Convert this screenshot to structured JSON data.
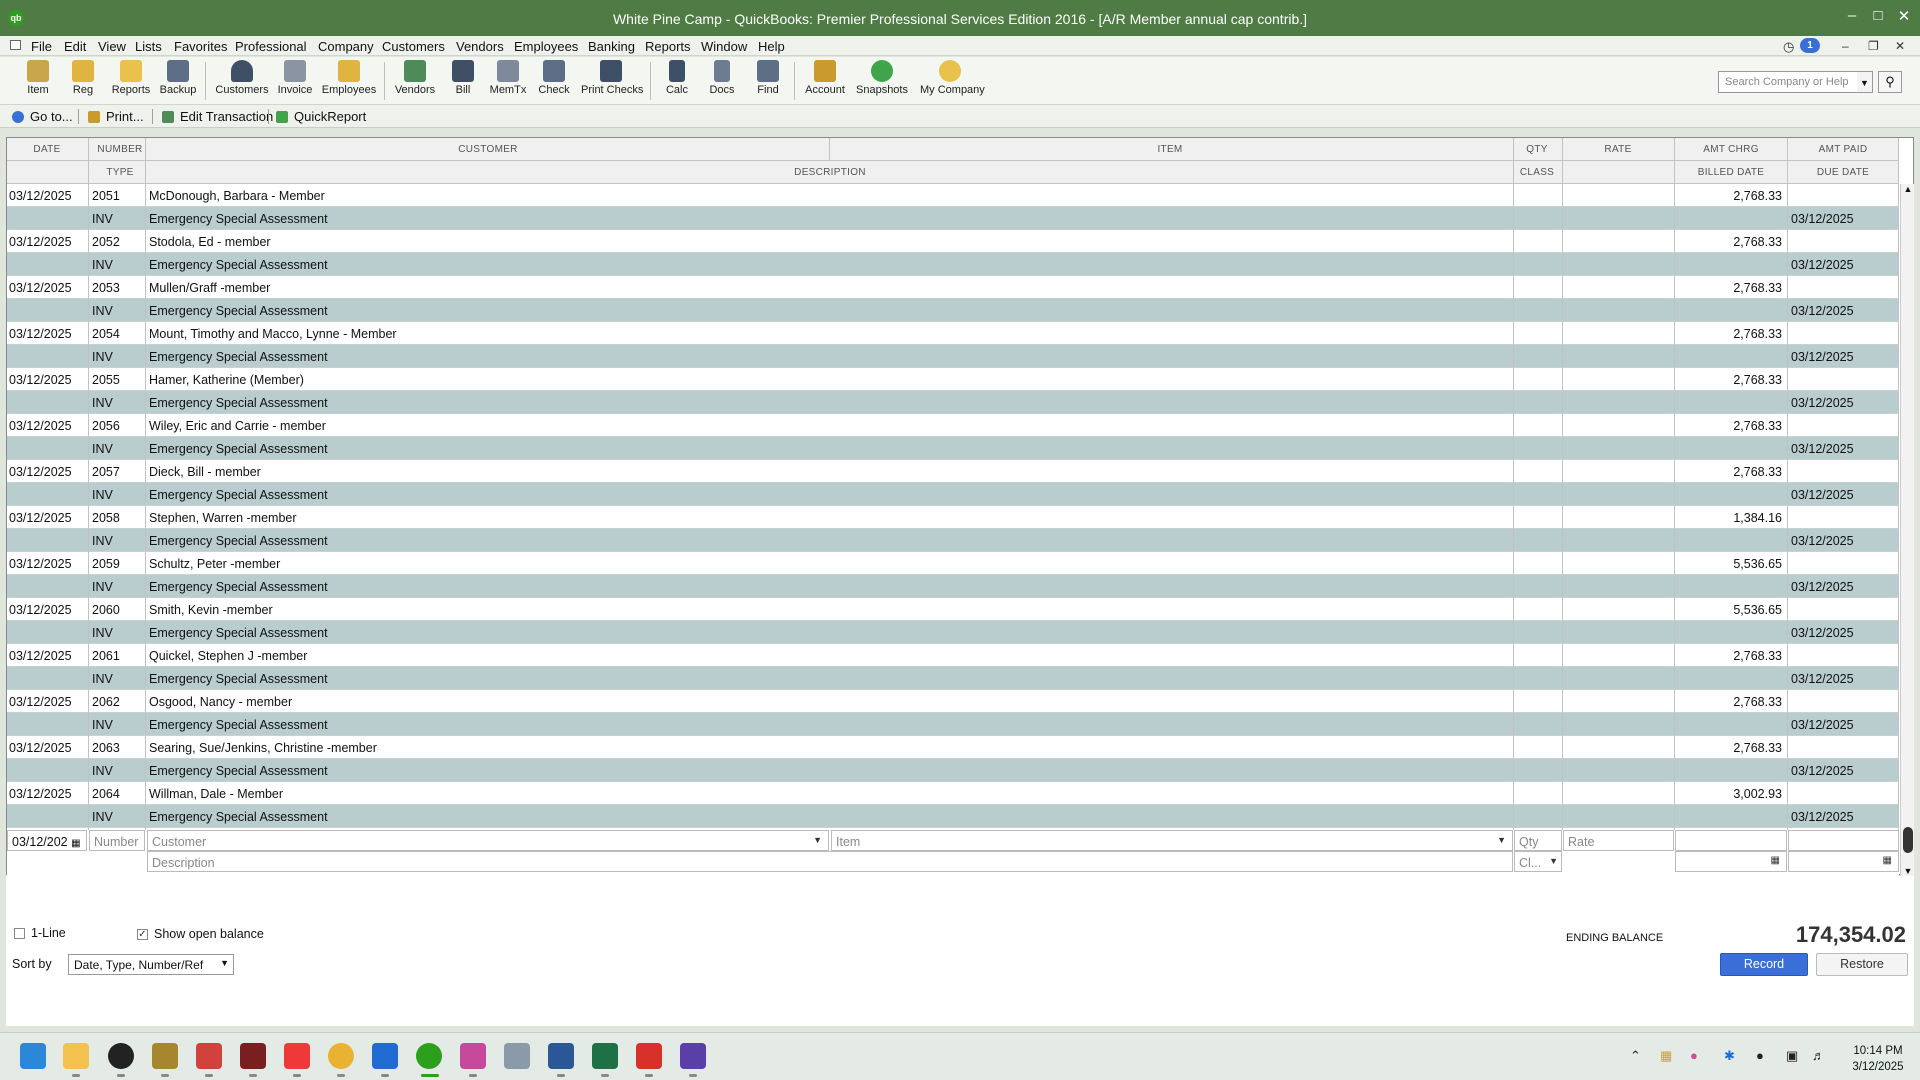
{
  "window": {
    "title": "White Pine Camp  - QuickBooks: Premier Professional Services Edition 2016 - [A/R Member annual cap contrib.]",
    "logo_text": "qb"
  },
  "menu": [
    "File",
    "Edit",
    "View",
    "Lists",
    "Favorites",
    "Professional",
    "Company",
    "Customers",
    "Vendors",
    "Employees",
    "Banking",
    "Reports",
    "Window",
    "Help"
  ],
  "reminders_count": "1",
  "toolbar": {
    "items": [
      {
        "label": "Item",
        "icon": "item-icon"
      },
      {
        "label": "Reg",
        "icon": "register-icon"
      },
      {
        "label": "Reports",
        "icon": "reports-icon"
      },
      {
        "label": "Backup",
        "icon": "backup-icon"
      },
      {
        "label": "Customers",
        "icon": "customers-icon"
      },
      {
        "label": "Invoice",
        "icon": "invoice-icon"
      },
      {
        "label": "Employees",
        "icon": "employees-icon"
      },
      {
        "label": "Vendors",
        "icon": "vendors-icon"
      },
      {
        "label": "Bill",
        "icon": "bill-icon"
      },
      {
        "label": "MemTx",
        "icon": "memtx-icon"
      },
      {
        "label": "Check",
        "icon": "check-icon"
      },
      {
        "label": "Print Checks",
        "icon": "print-checks-icon"
      },
      {
        "label": "Calc",
        "icon": "calc-icon"
      },
      {
        "label": "Docs",
        "icon": "docs-icon"
      },
      {
        "label": "Find",
        "icon": "find-icon"
      },
      {
        "label": "Account",
        "icon": "account-icon"
      },
      {
        "label": "Snapshots",
        "icon": "snapshots-icon"
      },
      {
        "label": "My Company",
        "icon": "my-company-icon"
      }
    ],
    "search_placeholder": "Search Company or Help"
  },
  "actions": {
    "goto": "Go to...",
    "print": "Print...",
    "edit_transaction": "Edit Transaction",
    "quickreport": "QuickReport"
  },
  "columns": {
    "row1": {
      "date": "DATE",
      "number": "NUMBER",
      "customer": "CUSTOMER",
      "item": "ITEM",
      "qty": "QTY",
      "rate": "RATE",
      "amt_chrg": "AMT CHRG",
      "amt_paid": "AMT PAID"
    },
    "row2": {
      "type": "TYPE",
      "description": "DESCRIPTION",
      "class": "CLASS",
      "billed_date": "BILLED DATE",
      "due_date": "DUE DATE"
    }
  },
  "transactions": [
    {
      "date": "03/12/2025",
      "number": "2051",
      "customer": "McDonough, Barbara - Member",
      "amt_chrg": "2,768.33",
      "type": "INV",
      "description": "Emergency Special Assessment",
      "due_date": "03/12/2025"
    },
    {
      "date": "03/12/2025",
      "number": "2052",
      "customer": "Stodola, Ed - member",
      "amt_chrg": "2,768.33",
      "type": "INV",
      "description": "Emergency Special Assessment",
      "due_date": "03/12/2025"
    },
    {
      "date": "03/12/2025",
      "number": "2053",
      "customer": "Mullen/Graff  -member",
      "amt_chrg": "2,768.33",
      "type": "INV",
      "description": "Emergency Special Assessment",
      "due_date": "03/12/2025"
    },
    {
      "date": "03/12/2025",
      "number": "2054",
      "customer": "Mount, Timothy and Macco, Lynne - Member",
      "amt_chrg": "2,768.33",
      "type": "INV",
      "description": "Emergency Special Assessment",
      "due_date": "03/12/2025"
    },
    {
      "date": "03/12/2025",
      "number": "2055",
      "customer": "Hamer, Katherine (Member)",
      "amt_chrg": "2,768.33",
      "type": "INV",
      "description": "Emergency Special Assessment",
      "due_date": "03/12/2025"
    },
    {
      "date": "03/12/2025",
      "number": "2056",
      "customer": "Wiley, Eric and Carrie - member",
      "amt_chrg": "2,768.33",
      "type": "INV",
      "description": "Emergency Special Assessment",
      "due_date": "03/12/2025"
    },
    {
      "date": "03/12/2025",
      "number": "2057",
      "customer": "Dieck, Bill - member",
      "amt_chrg": "2,768.33",
      "type": "INV",
      "description": "Emergency Special Assessment",
      "due_date": "03/12/2025"
    },
    {
      "date": "03/12/2025",
      "number": "2058",
      "customer": "Stephen, Warren  -member",
      "amt_chrg": "1,384.16",
      "type": "INV",
      "description": "Emergency Special Assessment",
      "due_date": "03/12/2025"
    },
    {
      "date": "03/12/2025",
      "number": "2059",
      "customer": "Schultz, Peter -member",
      "amt_chrg": "5,536.65",
      "type": "INV",
      "description": "Emergency Special Assessment",
      "due_date": "03/12/2025"
    },
    {
      "date": "03/12/2025",
      "number": "2060",
      "customer": "Smith, Kevin -member",
      "amt_chrg": "5,536.65",
      "type": "INV",
      "description": "Emergency Special Assessment",
      "due_date": "03/12/2025"
    },
    {
      "date": "03/12/2025",
      "number": "2061",
      "customer": "Quickel, Stephen  J -member",
      "amt_chrg": "2,768.33",
      "type": "INV",
      "description": "Emergency Special Assessment",
      "due_date": "03/12/2025"
    },
    {
      "date": "03/12/2025",
      "number": "2062",
      "customer": "Osgood, Nancy - member",
      "amt_chrg": "2,768.33",
      "type": "INV",
      "description": "Emergency Special Assessment",
      "due_date": "03/12/2025"
    },
    {
      "date": "03/12/2025",
      "number": "2063",
      "customer": "Searing, Sue/Jenkins, Christine -member",
      "amt_chrg": "2,768.33",
      "type": "INV",
      "description": "Emergency Special Assessment",
      "due_date": "03/12/2025"
    },
    {
      "date": "03/12/2025",
      "number": "2064",
      "customer": "Willman, Dale - Member",
      "amt_chrg": "3,002.93",
      "type": "INV",
      "description": "Emergency Special Assessment",
      "due_date": "03/12/2025"
    }
  ],
  "entry": {
    "date": "03/12/202",
    "number_placeholder": "Number",
    "customer_placeholder": "Customer",
    "item_placeholder": "Item",
    "qty_placeholder": "Qty",
    "rate_placeholder": "Rate",
    "description_placeholder": "Description",
    "class_placeholder": "Cl..."
  },
  "footer": {
    "one_line_label": "1-Line",
    "one_line_checked": false,
    "show_open_balance_label": "Show open balance",
    "show_open_balance_checked": true,
    "sort_by_label": "Sort by",
    "sort_by_value": "Date, Type, Number/Ref",
    "ending_balance_label": "ENDING BALANCE",
    "ending_balance_value": "174,354.02",
    "record_label": "Record",
    "restore_label": "Restore"
  },
  "taskbar": {
    "clock_time": "10:14 PM",
    "clock_date": "3/12/2025",
    "apps": [
      "windows-start-icon",
      "file-explorer-icon",
      "app-icon",
      "app-icon",
      "app-icon",
      "app-icon",
      "vivaldi-icon",
      "chrome-icon",
      "outlook-icon",
      "quickbooks-icon",
      "app-icon",
      "app-icon",
      "word-icon",
      "excel-icon",
      "acrobat-icon",
      "app-icon"
    ]
  },
  "colors": {
    "titlebar": "#4f7c45",
    "row_alt": "#b9cdce",
    "record_button": "#3a6fd8"
  }
}
